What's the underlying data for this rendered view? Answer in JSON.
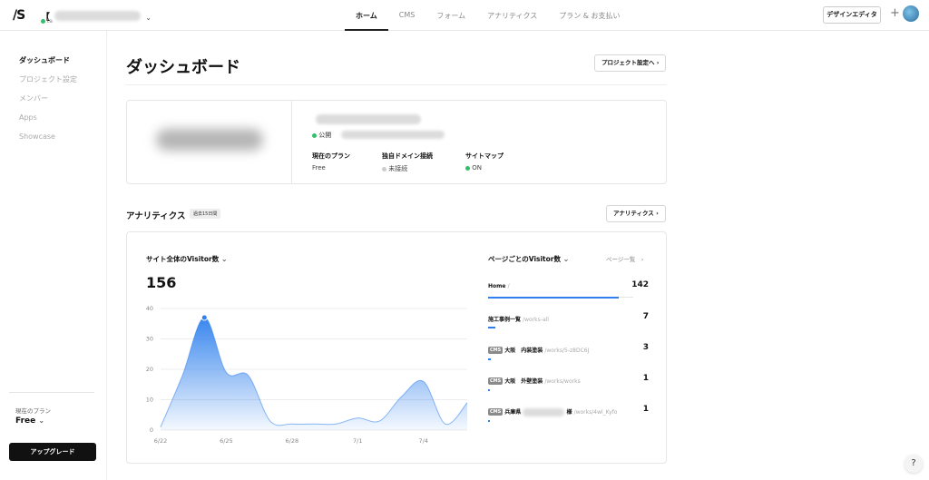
{
  "app": {
    "logo": "/S"
  },
  "project": {
    "name": "【",
    "status": "ta"
  },
  "nav": {
    "items": [
      "ホーム",
      "CMS",
      "フォーム",
      "アナリティクス",
      "プラン & お支払い"
    ]
  },
  "header": {
    "design_editor": "デザインエディタ",
    "plus": "+"
  },
  "sidebar": {
    "items": [
      "ダッシュボード",
      "プロジェクト設定",
      "メンバー",
      "Apps",
      "Showcase"
    ],
    "plan_label": "現在のプラン",
    "plan_value": "Free",
    "upgrade": "アップグレード"
  },
  "main": {
    "title": "ダッシュボード",
    "project_settings_button": "プロジェクト設定へ",
    "site": {
      "public_label": "公開",
      "plan_label": "現在のプラン",
      "plan_value": "Free",
      "domain_label": "独自ドメイン接続",
      "domain_value": "未接続",
      "sitemap_label": "サイトマップ",
      "sitemap_value": "ON"
    },
    "analytics": {
      "title": "アナリティクス",
      "period_badge": "過去15日間",
      "button": "アナリティクス",
      "visitor_title": "サイト全体のVisitor数",
      "visitor_total": "156",
      "page_list_title": "ページごとのVisitor数",
      "page_list_link": "ページ一覧",
      "pages": [
        {
          "cms": "",
          "name": "Home",
          "path": "/",
          "count": "142",
          "fraction": 0.9
        },
        {
          "cms": "",
          "name": "施工事例一覧",
          "path": "/works-all",
          "count": "7",
          "fraction": 0.05
        },
        {
          "cms": "CMS",
          "name": "大阪　内装塗装",
          "path": "/works/5-z8DC6J",
          "count": "3",
          "fraction": 0.02
        },
        {
          "cms": "CMS",
          "name": "大阪　外壁塗装",
          "path": "/works/works",
          "count": "1",
          "fraction": 0.01
        },
        {
          "cms": "CMS",
          "name": "兵庫県",
          "name2": "様",
          "path": "/works/4wl_Kyfo",
          "count": "1",
          "fraction": 0.01
        }
      ]
    }
  },
  "help": "?",
  "colors": {
    "accent": "#2f80ed",
    "status_green": "#31c06a"
  },
  "chart_data": {
    "type": "area",
    "x": [
      "6/22",
      "6/23",
      "6/24",
      "6/25",
      "6/26",
      "6/27",
      "6/28",
      "6/29",
      "6/30",
      "7/1",
      "7/2",
      "7/3",
      "7/4",
      "7/5",
      "7/6"
    ],
    "x_ticks": [
      "6/22",
      "6/25",
      "6/28",
      "7/1",
      "7/4"
    ],
    "values": [
      1,
      18,
      37,
      19,
      18,
      3,
      2,
      2,
      2,
      4,
      3,
      11,
      16,
      2,
      9
    ],
    "y_ticks": [
      "0",
      "10",
      "20",
      "30",
      "40"
    ],
    "ylim": [
      0,
      40
    ],
    "grid": true
  }
}
